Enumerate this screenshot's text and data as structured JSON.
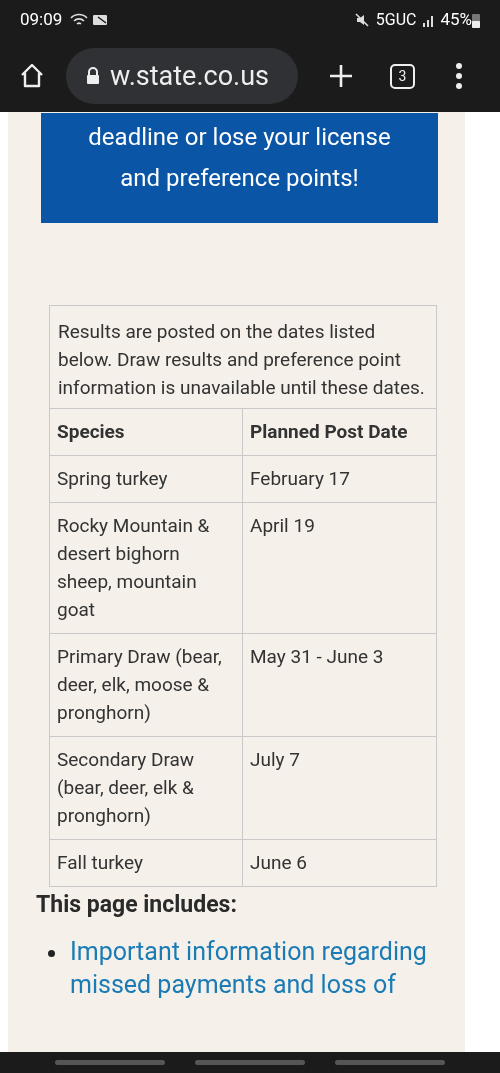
{
  "status_bar": {
    "time": "09:09",
    "network": "5GUC",
    "battery": "45%"
  },
  "browser": {
    "url": "w.state.co.us",
    "tab_count": "3"
  },
  "banner": {
    "lines": [
      "deadline or lose your license",
      "and preference points!"
    ]
  },
  "table": {
    "caption": "Results are posted on the dates listed below. Draw results and preference point information is unavailable until these dates.",
    "columns": [
      "Species",
      "Planned Post Date"
    ],
    "rows": [
      {
        "species": "Spring turkey",
        "date": "February 17"
      },
      {
        "species": "Rocky Mountain & desert bighorn sheep, mountain goat",
        "date": "April 19"
      },
      {
        "species": "Primary Draw (bear, deer, elk, moose & pronghorn)",
        "date": "May 31 - June 3"
      },
      {
        "species": "Secondary Draw (bear, deer, elk & pronghorn)",
        "date": "July 7"
      },
      {
        "species": "Fall turkey",
        "date": "June 6"
      }
    ]
  },
  "section": {
    "heading": "This page includes:",
    "links": [
      "Important information regarding missed payments and loss of"
    ]
  }
}
